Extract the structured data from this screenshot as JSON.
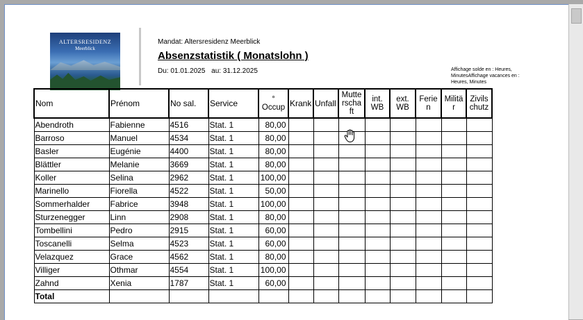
{
  "header": {
    "logo_line1": "ALTERSRESIDENZ",
    "logo_line2": "Meerblick",
    "mandat": "Mandat: Altersresidenz Meerblick",
    "title": "Absenzstatistik ( Monatslohn )",
    "period_from": "Du: 01.01.2025",
    "period_to": "au: 31.12.2025",
    "note": "Affichage solde en : Heures, MinutesAffichage vacances en : Heures, Minutes"
  },
  "table": {
    "columns": [
      "Nom",
      "Prénom",
      "No sal.",
      "Service",
      "°\nOccup",
      "Krank",
      "Unfall",
      "Mutterschaft",
      "int. WB",
      "ext. WB",
      "Ferien",
      "Militär",
      "Zivilschutz"
    ],
    "column_display": {
      "occup_degree": "°",
      "occup": "Occup",
      "mutter1": "Mutte",
      "mutter2": "rscha",
      "mutter3": "ft",
      "int1": "int.",
      "int2": "WB",
      "ext1": "ext.",
      "ext2": "WB",
      "ferien1": "Ferie",
      "ferien2": "n",
      "militaer1": "Militä",
      "militaer2": "r",
      "zivil1": "Zivils",
      "zivil2": "chutz"
    },
    "rows": [
      {
        "nom": "Abendroth",
        "prenom": "Fabienne",
        "nosal": "4516",
        "service": "Stat. 1",
        "occup": "80,00"
      },
      {
        "nom": "Barroso",
        "prenom": "Manuel",
        "nosal": "4534",
        "service": "Stat. 1",
        "occup": "80,00"
      },
      {
        "nom": "Basler",
        "prenom": "Eugénie",
        "nosal": "4400",
        "service": "Stat. 1",
        "occup": "80,00"
      },
      {
        "nom": "Blättler",
        "prenom": "Melanie",
        "nosal": "3669",
        "service": "Stat. 1",
        "occup": "80,00"
      },
      {
        "nom": "Koller",
        "prenom": "Selina",
        "nosal": "2962",
        "service": "Stat. 1",
        "occup": "100,00"
      },
      {
        "nom": "Marinello",
        "prenom": "Fiorella",
        "nosal": "4522",
        "service": "Stat. 1",
        "occup": "50,00"
      },
      {
        "nom": "Sommerhalder",
        "prenom": "Fabrice",
        "nosal": "3948",
        "service": "Stat. 1",
        "occup": "100,00"
      },
      {
        "nom": "Sturzenegger",
        "prenom": "Linn",
        "nosal": "2908",
        "service": "Stat. 1",
        "occup": "80,00"
      },
      {
        "nom": "Tombellini",
        "prenom": "Pedro",
        "nosal": "2915",
        "service": "Stat. 1",
        "occup": "60,00"
      },
      {
        "nom": "Toscanelli",
        "prenom": "Selma",
        "nosal": "4523",
        "service": "Stat. 1",
        "occup": "60,00"
      },
      {
        "nom": "Velazquez",
        "prenom": "Grace",
        "nosal": "4562",
        "service": "Stat. 1",
        "occup": "80,00"
      },
      {
        "nom": "Villiger",
        "prenom": "Othmar",
        "nosal": "4554",
        "service": "Stat. 1",
        "occup": "100,00"
      },
      {
        "nom": "Zahnd",
        "prenom": "Xenia",
        "nosal": "1787",
        "service": "Stat. 1",
        "occup": "60,00"
      }
    ],
    "total_label": "Total"
  },
  "cursor": "hand-pointer-icon",
  "colors": {
    "page_bg": "#ffffff",
    "frame_bg": "#a9a9a9",
    "frame_accent": "#6d8fc7"
  }
}
